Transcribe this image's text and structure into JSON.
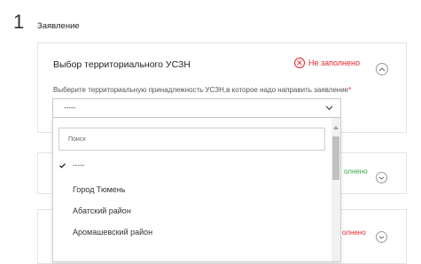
{
  "step": {
    "number": "1",
    "title": "Заявление"
  },
  "section": {
    "title": "Выбор территориального УСЗН",
    "status_label": "Не заполнено",
    "field_hint": "Выберите территориальную принадлежность УСЗН,в которое надо направить заявление",
    "required_mark": "*",
    "select_value": "-----"
  },
  "dropdown": {
    "search_placeholder": "Поиск",
    "options": [
      {
        "label": "-----",
        "selected": true
      },
      {
        "label": "Город Тюмень",
        "selected": false
      },
      {
        "label": "Абатский район",
        "selected": false
      },
      {
        "label": "Аромашевский район",
        "selected": false
      }
    ]
  },
  "other_sections": [
    {
      "status_partial": "олнено"
    },
    {
      "status_partial": "олнено"
    }
  ],
  "colors": {
    "error": "#e2262a",
    "success": "#3aa54a",
    "scroll_thumb": "#c1c1c1"
  },
  "icons": {
    "status": "close-circle-icon",
    "collapse": "chevron-up-icon",
    "expand": "chevron-down-icon",
    "select_arrow": "chevron-down-icon",
    "selected": "checkmark-icon"
  }
}
